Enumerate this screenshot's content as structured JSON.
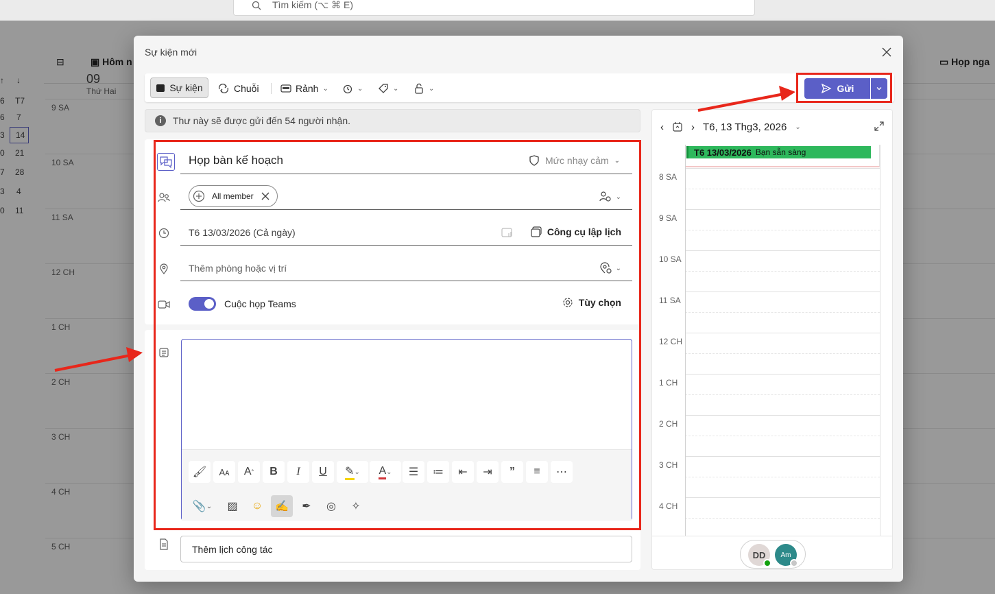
{
  "search": {
    "placeholder": "Tìm kiếm (⌥ ⌘ E)"
  },
  "background": {
    "today_label": "Hôm n",
    "day_number": "09",
    "day_name": "Thứ Hai",
    "meet_now": "Họp nga",
    "mini_cal_header": [
      "6",
      "T7"
    ],
    "mini_cal_rows": [
      [
        "6",
        "7"
      ],
      [
        "3",
        "14"
      ],
      [
        "0",
        "21"
      ],
      [
        "7",
        "28"
      ],
      [
        "3",
        "4"
      ],
      [
        "0",
        "11"
      ]
    ],
    "hours": [
      "9 SA",
      "10 SA",
      "11 SA",
      "12 CH",
      "1 CH",
      "2 CH",
      "3 CH",
      "4 CH",
      "5 CH"
    ]
  },
  "modal": {
    "title": "Sự kiện mới",
    "toolbar": {
      "event": "Sự kiện",
      "series": "Chuỗi",
      "free": "Rảnh"
    },
    "send": {
      "label": "Gửi"
    },
    "info": "Thư này sẽ được gửi đến 54 người nhận.",
    "form": {
      "title": "Họp bàn kế hoạch",
      "sensitivity": "Mức nhạy cảm",
      "attendee_chip": "All member",
      "date": "T6 13/03/2026 (Cả ngày)",
      "scheduling_assistant": "Công cụ lập lịch",
      "location_placeholder": "Thêm phòng hoặc vị trí",
      "teams_meeting": "Cuộc họp Teams",
      "options": "Tùy chọn"
    },
    "add_calendar": "Thêm lịch công tác"
  },
  "side_panel": {
    "date": "T6, 13 Thg3, 2026",
    "all_day_date": "T6 13/03/2026",
    "all_day_status": "Bạn sẵn sàng",
    "hours": [
      "8 SA",
      "9 SA",
      "10 SA",
      "11 SA",
      "12 CH",
      "1 CH",
      "2 CH",
      "3 CH",
      "4 CH"
    ],
    "avatars": [
      "DD",
      "Am"
    ]
  },
  "colors": {
    "accent": "#5b5fc7",
    "highlight_box": "#e8271b",
    "free_green": "#2eb85c"
  }
}
